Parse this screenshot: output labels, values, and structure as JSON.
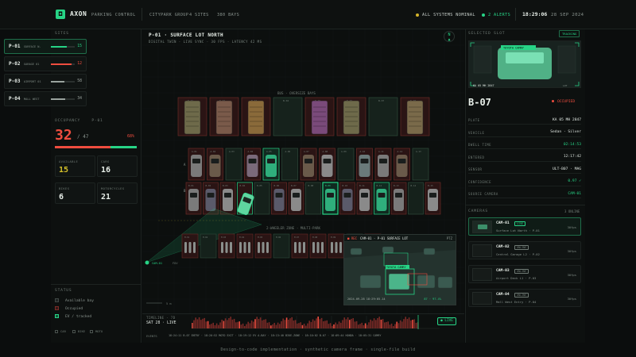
{
  "header": {
    "brand": "AXON",
    "brand_sub": "PARKING CONTROL",
    "group": "CITYPARK GROUP",
    "sites": "4 SITES",
    "bays": "380 BAYS",
    "status": "ALL SYSTEMS NOMINAL",
    "alerts": "2 ALERTS",
    "time": "18:29:06",
    "date": "28 SEP 2024"
  },
  "sites": {
    "title": "SITES",
    "items": [
      {
        "id": "P-01",
        "name": "SURFACE N.",
        "count": "15",
        "fill": 0.68,
        "color": "#27d486"
      },
      {
        "id": "P-02",
        "name": "GARAGE 01",
        "count": "12",
        "fill": 0.85,
        "color": "#ef4d3f"
      },
      {
        "id": "P-03",
        "name": "AIRPORT 01",
        "count": "58",
        "fill": 0.55,
        "color": "#9aa39e"
      },
      {
        "id": "P-04",
        "name": "MALL WEST",
        "count": "34",
        "fill": 0.6,
        "color": "#9aa39e"
      }
    ]
  },
  "occupancy": {
    "title": "OCCUPANCY",
    "site": "P-01",
    "occupied": "32",
    "total": "/ 47",
    "percent": "68%",
    "fraction": 0.68
  },
  "stats": [
    {
      "label": "AVAILABLE",
      "value": "15",
      "color": "#d4c02a"
    },
    {
      "label": "CARS",
      "value": "16",
      "color": "#e8efe9"
    },
    {
      "label": "BIKES",
      "value": "6",
      "color": "#e8efe9"
    },
    {
      "label": "MOTORCYCLES",
      "value": "21",
      "color": "#e8efe9"
    }
  ],
  "status_legend": {
    "title": "STATUS",
    "items": [
      {
        "label": "Available bay",
        "color": "#3f4744"
      },
      {
        "label": "Occupied",
        "color": "#7a2a26"
      },
      {
        "label": "EV / tracked",
        "color": "#27d486"
      }
    ]
  },
  "view_toggles": [
    "CAR",
    "BIKE",
    "MOTO"
  ],
  "map": {
    "title": "P-01 · SURFACE LOT NORTH",
    "subtitle": "DIGITAL TWIN · LIVE SYNC · 30 FPS · LATENCY 42 MS",
    "compass": "N",
    "bus_label": "BUS · OVERSIZE BAYS",
    "two_wheeler_label": "2-WHEELER ZONE · MULTI-PARK",
    "row_a": "A",
    "row_b": "B",
    "cam_label": "CAM-01",
    "cam_fov": "FOV",
    "scale": "5 m",
    "tracked_tag": "B-07"
  },
  "overlay": {
    "title": "CAM-01 · P-01 SURFACE LOT",
    "rec": "REC",
    "fps": "PTZ",
    "tag": "TOYOTA CAMRY",
    "ts": "2024-09-28 18:29:05.14",
    "conf": "87 · 97.4%"
  },
  "timeline": {
    "label": "TIMELINE · 7D",
    "day": "SAT 28 · LIVE",
    "live": "● LIVE",
    "events_label": "EVENTS",
    "events": "18:24:11 B-07 ENTRY · 18:20:52 MOTO EXIT · 18:19:12 EV A-BAY · 18:13:40 BIKE-ZONE · 18:10:02 B-07 · 18:09:44 HONDA · 18:05:31 CAMRY"
  },
  "selected": {
    "title": "SELECTED SLOT",
    "tracking": "TRACKING",
    "slot": "B-07",
    "state": "OCCUPIED",
    "preview_tag": "TOYOTA CAMRY",
    "preview_id": "KA 05 MH 2847",
    "preview_meta": "LOT",
    "fields": [
      {
        "k": "PLATE",
        "v": "KA 05 MH 2847",
        "c": "#dfe6e1"
      },
      {
        "k": "VEHICLE",
        "v": "Sedan · Silver",
        "c": "#dfe6e1"
      },
      {
        "k": "DWELL TIME",
        "v": "02:14:53",
        "c": "#27d486"
      },
      {
        "k": "ENTERED",
        "v": "12:17:42",
        "c": "#dfe6e1"
      },
      {
        "k": "SENSOR",
        "v": "ULT-B07 · MAG",
        "c": "#dfe6e1"
      },
      {
        "k": "CONFIDENCE",
        "v": "0.97 ✓",
        "c": "#27d486"
      },
      {
        "k": "SOURCE CAMERA",
        "v": "CAM-01",
        "c": "#27d486"
      }
    ]
  },
  "cameras": {
    "title": "CAMERAS",
    "online": "3 ONLINE",
    "items": [
      {
        "id": "CAM-01",
        "state": "LIVE",
        "name": "Surface Lot North · P-01",
        "fps": "30fps",
        "active": true,
        "sc": "#27d486"
      },
      {
        "id": "CAM-02",
        "state": "ONLINE",
        "name": "Central Garage L2 · P-02",
        "fps": "30fps",
        "active": false,
        "sc": "#6f7a74"
      },
      {
        "id": "CAM-03",
        "state": "ONLINE",
        "name": "Airport Deck L1 · P-03",
        "fps": "30fps",
        "active": false,
        "sc": "#6f7a74"
      },
      {
        "id": "CAM-04",
        "state": "ONLINE",
        "name": "Mall West Entry · P-04",
        "fps": "30fps",
        "active": false,
        "sc": "#6f7a74"
      }
    ]
  },
  "footer": "Design-to-code implementation · synthetic camera frame · single-file build"
}
